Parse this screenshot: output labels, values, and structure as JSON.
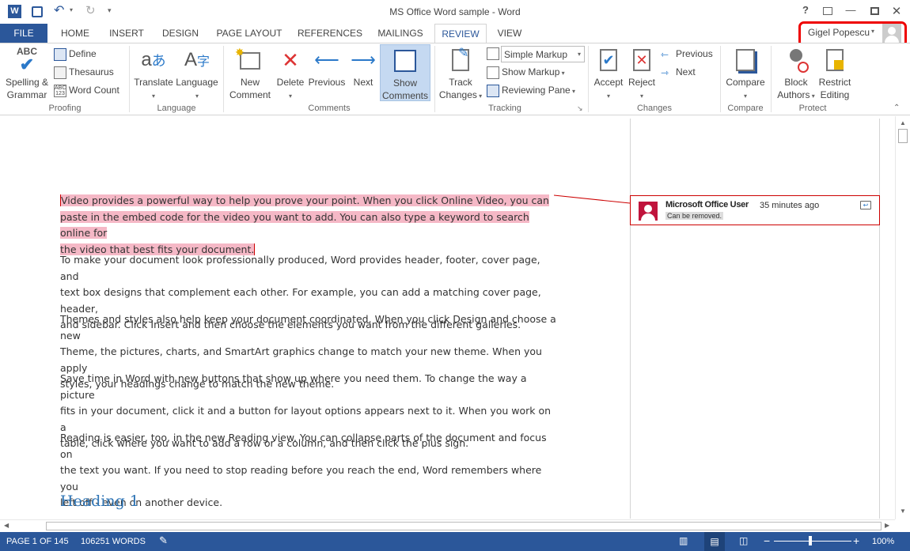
{
  "app": {
    "title": "MS Office Word sample - Word"
  },
  "qat": {
    "undo": "↶",
    "redo": "↻"
  },
  "tabs": [
    "FILE",
    "HOME",
    "INSERT",
    "DESIGN",
    "PAGE LAYOUT",
    "REFERENCES",
    "MAILINGS",
    "REVIEW",
    "VIEW"
  ],
  "user": {
    "name": "Gigel Popescu"
  },
  "ribbon": {
    "proofing": {
      "label": "Proofing",
      "spelling": "Spelling &",
      "grammar": "Grammar",
      "define": "Define",
      "thesaurus": "Thesaurus",
      "word_count": "Word Count"
    },
    "language": {
      "label": "Language",
      "translate": "Translate",
      "language": "Language"
    },
    "comments": {
      "label": "Comments",
      "new_comment_1": "New",
      "new_comment_2": "Comment",
      "delete": "Delete",
      "previous": "Previous",
      "next": "Next",
      "show_1": "Show",
      "show_2": "Comments"
    },
    "tracking": {
      "label": "Tracking",
      "track_1": "Track",
      "track_2": "Changes",
      "markup_select": "Simple Markup",
      "show_markup": "Show Markup",
      "reviewing_pane": "Reviewing Pane"
    },
    "changes": {
      "label": "Changes",
      "accept": "Accept",
      "reject": "Reject",
      "previous": "Previous",
      "next": "Next"
    },
    "compare": {
      "label": "Compare",
      "compare": "Compare"
    },
    "protect": {
      "label": "Protect",
      "block_1": "Block",
      "block_2": "Authors",
      "restrict_1": "Restrict",
      "restrict_2": "Editing"
    }
  },
  "document": {
    "p1_l1": "Video provides a powerful way to help you prove your point. When you click Online Video, you can",
    "p1_l2": "paste in the embed code for the video you want to add. You can also type a keyword to search online for",
    "p1_l3": "the video that best fits your document.",
    "p2_l1": "To make your document look professionally produced, Word provides header, footer, cover page, and",
    "p2_l2": "text box designs that complement each other. For example, you can add a matching cover page, header,",
    "p2_l3": "and sidebar. Click Insert and then choose the elements you want from the different galleries.",
    "p3_l1": "Themes and styles also help keep your document coordinated. When you click Design and choose a new",
    "p3_l2": "Theme, the pictures, charts, and SmartArt graphics change to match your new theme. When you apply",
    "p3_l3": "styles, your headings change to match the new theme.",
    "p4_l1": "Save time in Word with new buttons that show up where you need them. To change the way a picture",
    "p4_l2": "fits in your document, click it and a button for layout options appears next to it. When you work on a",
    "p4_l3": "table, click where you want to add a row or a column, and then click the plus sign.",
    "p5_l1": "Reading is easier, too, in the new Reading view. You can collapse parts of the document and focus on",
    "p5_l2": "the text you want. If you need to stop reading before you reach the end, Word remembers where you",
    "p5_l3": "left off - even on another device.",
    "heading": "Heading 1"
  },
  "comment": {
    "author": "Microsoft Office User",
    "time": "35 minutes ago",
    "text": "Can be removed."
  },
  "status": {
    "page": "PAGE 1 OF 145",
    "words": "106251 WORDS",
    "zoom": "100%"
  },
  "colors": {
    "accent": "#2b579a",
    "highlight": "#f5b8c6",
    "comment_border": "#cc0000"
  }
}
